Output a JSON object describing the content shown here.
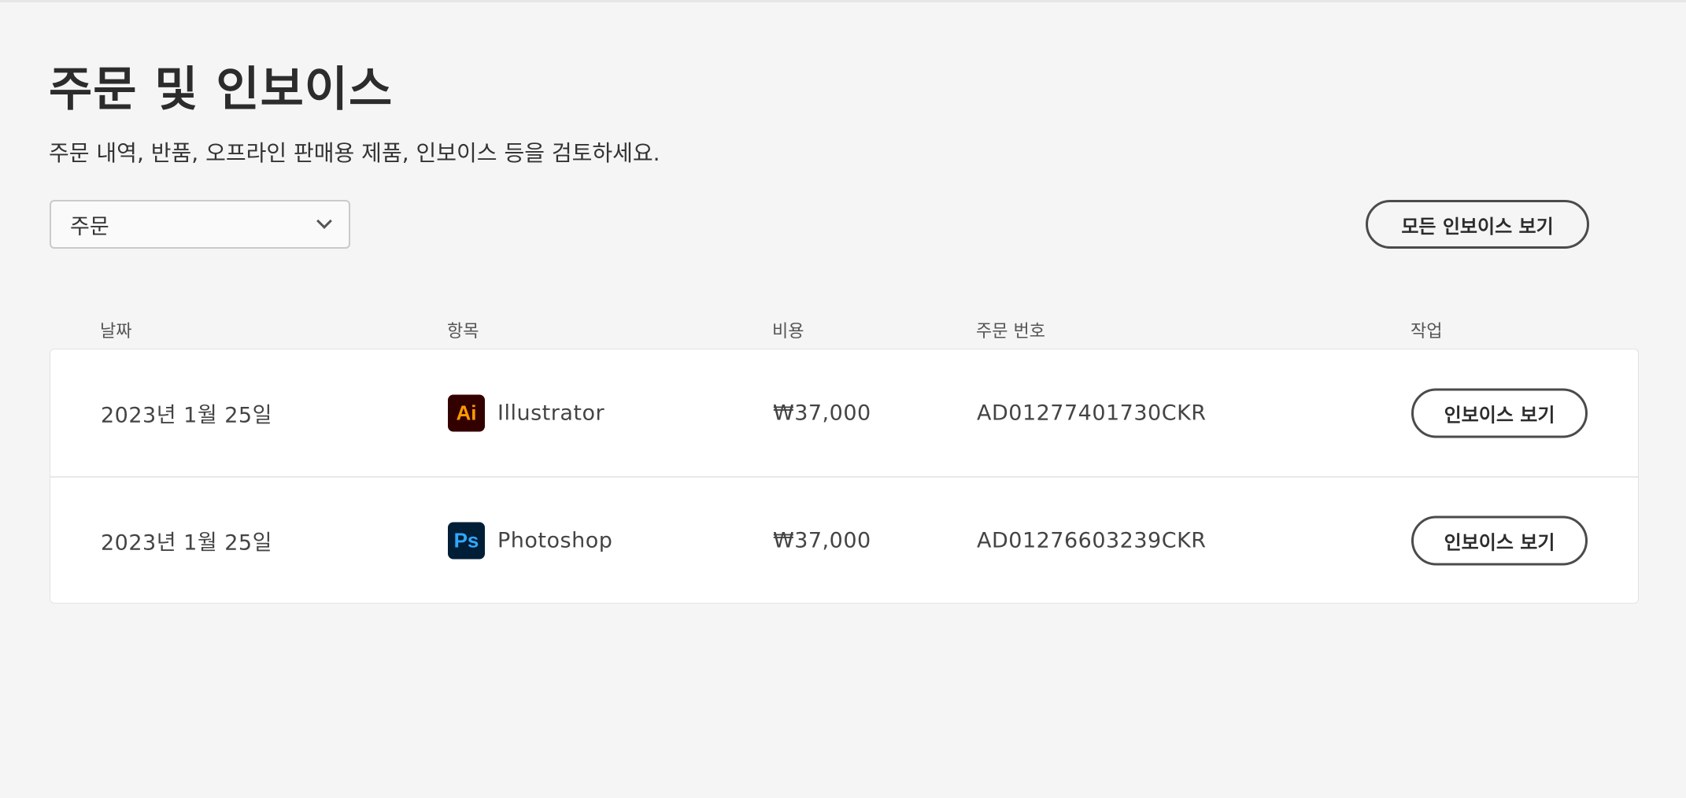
{
  "page": {
    "title": "주문 및 인보이스",
    "subtitle": "주문 내역, 반품, 오프라인 판매용 제품, 인보이스 등을 검토하세요."
  },
  "filter": {
    "selected": "주문"
  },
  "view_all_label": "모든 인보이스 보기",
  "table": {
    "headers": [
      "날짜",
      "항목",
      "비용",
      "주문 번호",
      "작업"
    ],
    "rows": [
      {
        "date": "2023년 1월 25일",
        "icon_text": "Ai",
        "icon_bg": "#330000",
        "icon_fg": "#ff9a00",
        "product": "Illustrator",
        "cost": "₩37,000",
        "order": "AD01277401730CKR",
        "action": "인보이스 보기"
      },
      {
        "date": "2023년 1월 25일",
        "icon_text": "Ps",
        "icon_bg": "#001e36",
        "icon_fg": "#31a8ff",
        "product": "Photoshop",
        "cost": "₩37,000",
        "order": "AD01276603239CKR",
        "action": "인보이스 보기"
      }
    ]
  }
}
